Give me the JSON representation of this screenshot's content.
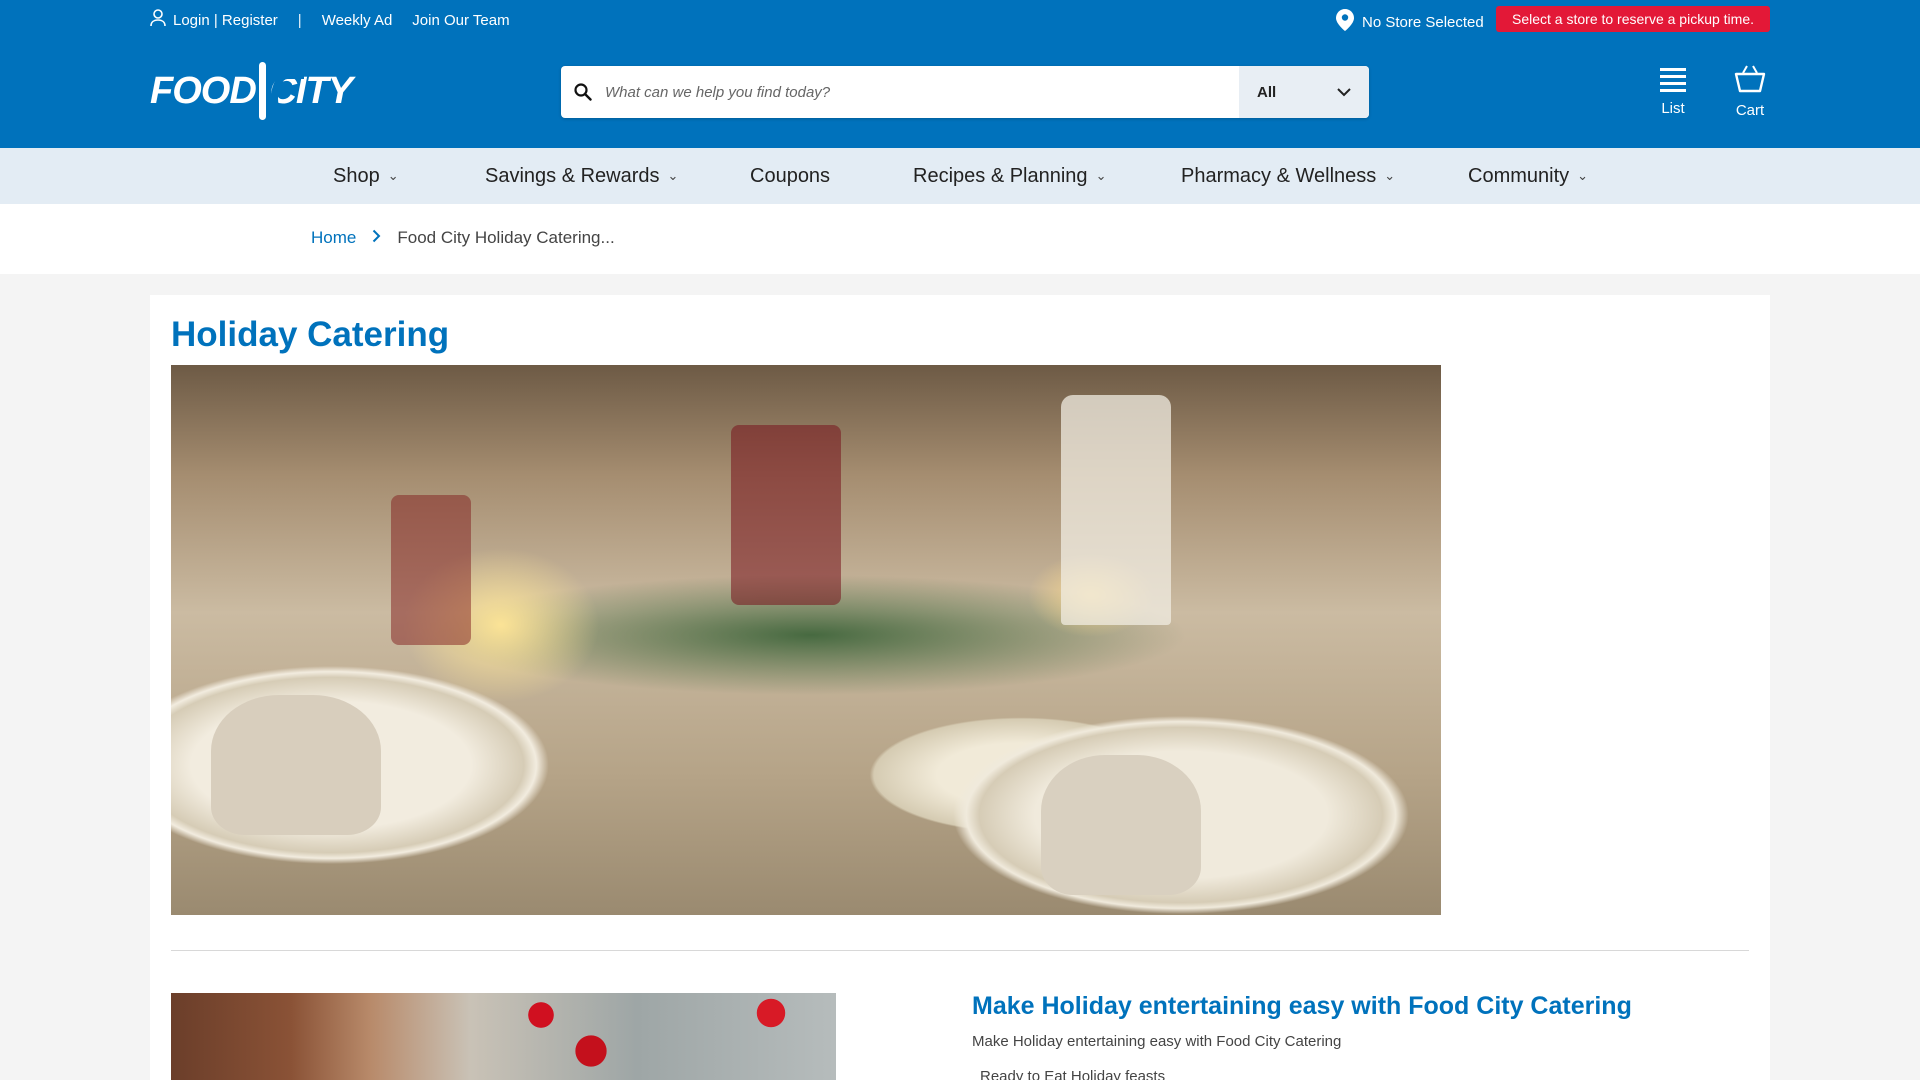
{
  "utility": {
    "login": "Login | Register",
    "separator": "|",
    "weekly_ad": "Weekly Ad",
    "join_team": "Join Our Team"
  },
  "store": {
    "label": "No Store Selected",
    "pickup_notice": "Select a store to reserve a pickup time."
  },
  "logo": {
    "word_left": "FOOD",
    "word_right": "CITY"
  },
  "search": {
    "placeholder": "What can we help you find today?",
    "category": "All"
  },
  "header_buttons": {
    "list": "List",
    "cart": "Cart"
  },
  "nav": {
    "items": [
      {
        "label": "Shop",
        "has_dropdown": true
      },
      {
        "label": "Savings & Rewards",
        "has_dropdown": true
      },
      {
        "label": "Coupons",
        "has_dropdown": false
      },
      {
        "label": "Recipes & Planning",
        "has_dropdown": true
      },
      {
        "label": "Pharmacy & Wellness",
        "has_dropdown": true
      },
      {
        "label": "Community",
        "has_dropdown": true
      }
    ]
  },
  "breadcrumb": {
    "home": "Home",
    "current": "Food City Holiday Catering..."
  },
  "main": {
    "title": "Holiday Catering",
    "section_title": "Make Holiday entertaining easy with Food City Catering",
    "section_text": "Make Holiday entertaining easy with Food City Catering",
    "section_bullet": "Ready to Eat Holiday feasts"
  },
  "colors": {
    "brand_blue": "#0072bc",
    "nav_bg": "#e3ecf4",
    "alert_red": "#e31837"
  },
  "icons": [
    "user-icon",
    "map-pin-icon",
    "search-icon",
    "chevron-down-icon",
    "list-icon",
    "cart-icon",
    "chevron-right-icon"
  ]
}
